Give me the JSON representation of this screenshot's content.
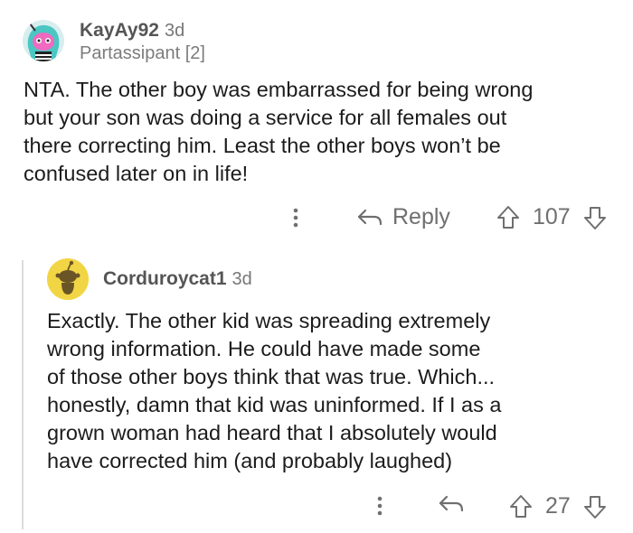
{
  "comments": [
    {
      "username": "KayAy92",
      "age": "3d",
      "flair": "Partassipant [2]",
      "body_lines": [
        "NTA. The other boy was embarrassed for being wrong",
        "but your son was doing a service for all females out",
        "there correcting him. Least the other boys won’t be",
        "confused later on in life!"
      ],
      "reply_label": "Reply",
      "score": "107"
    },
    {
      "username": "Corduroycat1",
      "age": "3d",
      "body_lines": [
        "Exactly. The other kid was spreading extremely",
        "wrong information. He could have made some",
        "of those other boys think that was true. Which...",
        "honestly, damn that kid was uninformed. If I as a",
        "grown woman had heard that I absolutely would",
        "have corrected him (and probably laughed)"
      ],
      "score": "27"
    }
  ],
  "icons": {
    "more": "more-vertical-icon",
    "reply": "reply-arrow-icon",
    "upvote": "upvote-arrow-icon",
    "downvote": "downvote-arrow-icon"
  },
  "colors": {
    "avatar1_bg": "#a2dfe0",
    "avatar2_bg": "#f2d544",
    "muted_text": "#777777"
  }
}
